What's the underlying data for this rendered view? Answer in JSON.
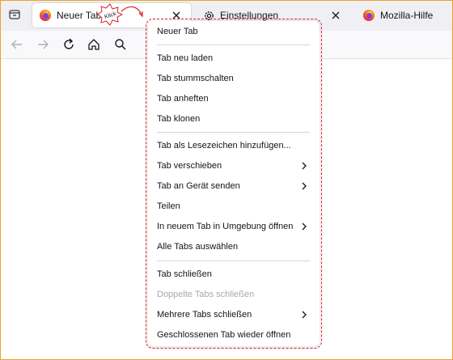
{
  "tabs": [
    {
      "title": "Neuer Tab",
      "icon": "firefox-icon"
    },
    {
      "title": "Einstellungen",
      "icon": "gear-icon"
    },
    {
      "title": "Mozilla-Hilfe",
      "icon": "firefox-icon"
    }
  ],
  "annotation": {
    "text": "Klick"
  },
  "menu": {
    "items": [
      {
        "label": "Neuer Tab",
        "disabled": false,
        "submenu": false
      },
      {
        "label": "Tab neu laden",
        "disabled": false,
        "submenu": false
      },
      {
        "label": "Tab stummschalten",
        "disabled": false,
        "submenu": false
      },
      {
        "label": "Tab anheften",
        "disabled": false,
        "submenu": false
      },
      {
        "label": "Tab klonen",
        "disabled": false,
        "submenu": false
      },
      {
        "label": "Tab als Lesezeichen hinzufügen...",
        "disabled": false,
        "submenu": false
      },
      {
        "label": "Tab verschieben",
        "disabled": false,
        "submenu": true
      },
      {
        "label": "Tab an Gerät senden",
        "disabled": false,
        "submenu": true
      },
      {
        "label": "Teilen",
        "disabled": false,
        "submenu": false
      },
      {
        "label": "In neuem Tab in Umgebung öffnen",
        "disabled": false,
        "submenu": true
      },
      {
        "label": "Alle Tabs auswählen",
        "disabled": false,
        "submenu": false
      },
      {
        "label": "Tab schließen",
        "disabled": false,
        "submenu": false
      },
      {
        "label": "Doppelte Tabs schließen",
        "disabled": true,
        "submenu": false
      },
      {
        "label": "Mehrere Tabs schließen",
        "disabled": false,
        "submenu": true
      },
      {
        "label": "Geschlossenen Tab wieder öffnen",
        "disabled": false,
        "submenu": false
      }
    ]
  },
  "colors": {
    "highlight_outline": "#d8242c",
    "frame": "#f0a030",
    "disabled_text": "#a8a8ae"
  }
}
